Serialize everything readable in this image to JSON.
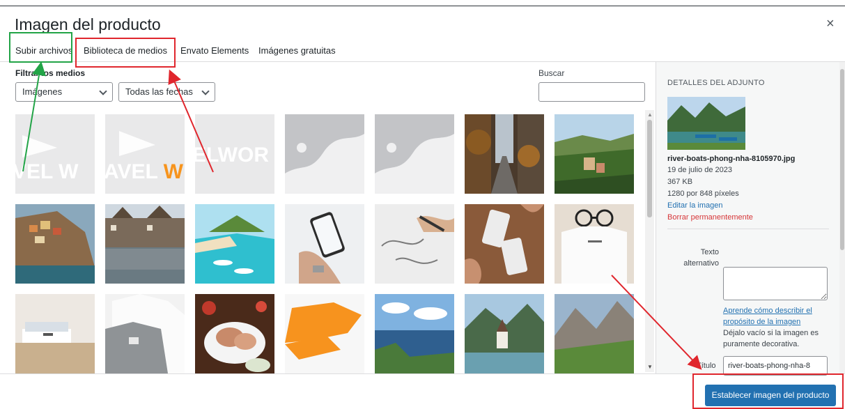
{
  "modal": {
    "title": "Imagen del producto",
    "close_symbol": "×"
  },
  "tabs": [
    {
      "label": "Subir archivos"
    },
    {
      "label": "Biblioteca de medios"
    },
    {
      "label": "Envato Elements"
    },
    {
      "label": "Imágenes gratuitas"
    }
  ],
  "filters": {
    "label": "Filtrar los medios",
    "type_select": "Imágenes",
    "date_select": "Todas las fechas"
  },
  "search": {
    "label": "Buscar",
    "value": ""
  },
  "attachment": {
    "section_title": "DETALLES DEL ADJUNTO",
    "filename": "river-boats-phong-nha-8105970.jpg",
    "date": "19 de julio de 2023",
    "size": "367 KB",
    "dimensions": "1280 por 848 píxeles",
    "edit_link": "Editar la imagen",
    "delete_link": "Borrar permanentemente",
    "alt_label_line1": "Texto",
    "alt_label_line2": "alternativo",
    "alt_value": "",
    "alt_help_link": "Aprende cómo describir el propósito de la imagen",
    "alt_help_text": "Déjalo vacío si la imagen es puramente decorativa.",
    "title_label": "Título",
    "title_value": "river-boats-phong-nha-8"
  },
  "thumbnail_text": {
    "t1": "VEL W",
    "t2_a": "AVEL ",
    "t2_b": "W",
    "t3": "ELWOR"
  },
  "footer": {
    "primary_button": "Establecer imagen del producto"
  },
  "colors": {
    "accent": "#2271b1",
    "danger": "#d63638",
    "annotation_green": "#22a447",
    "annotation_red": "#e0262d"
  },
  "icons": {
    "close": "close-icon",
    "dropdown": "chevron-down-icon"
  }
}
